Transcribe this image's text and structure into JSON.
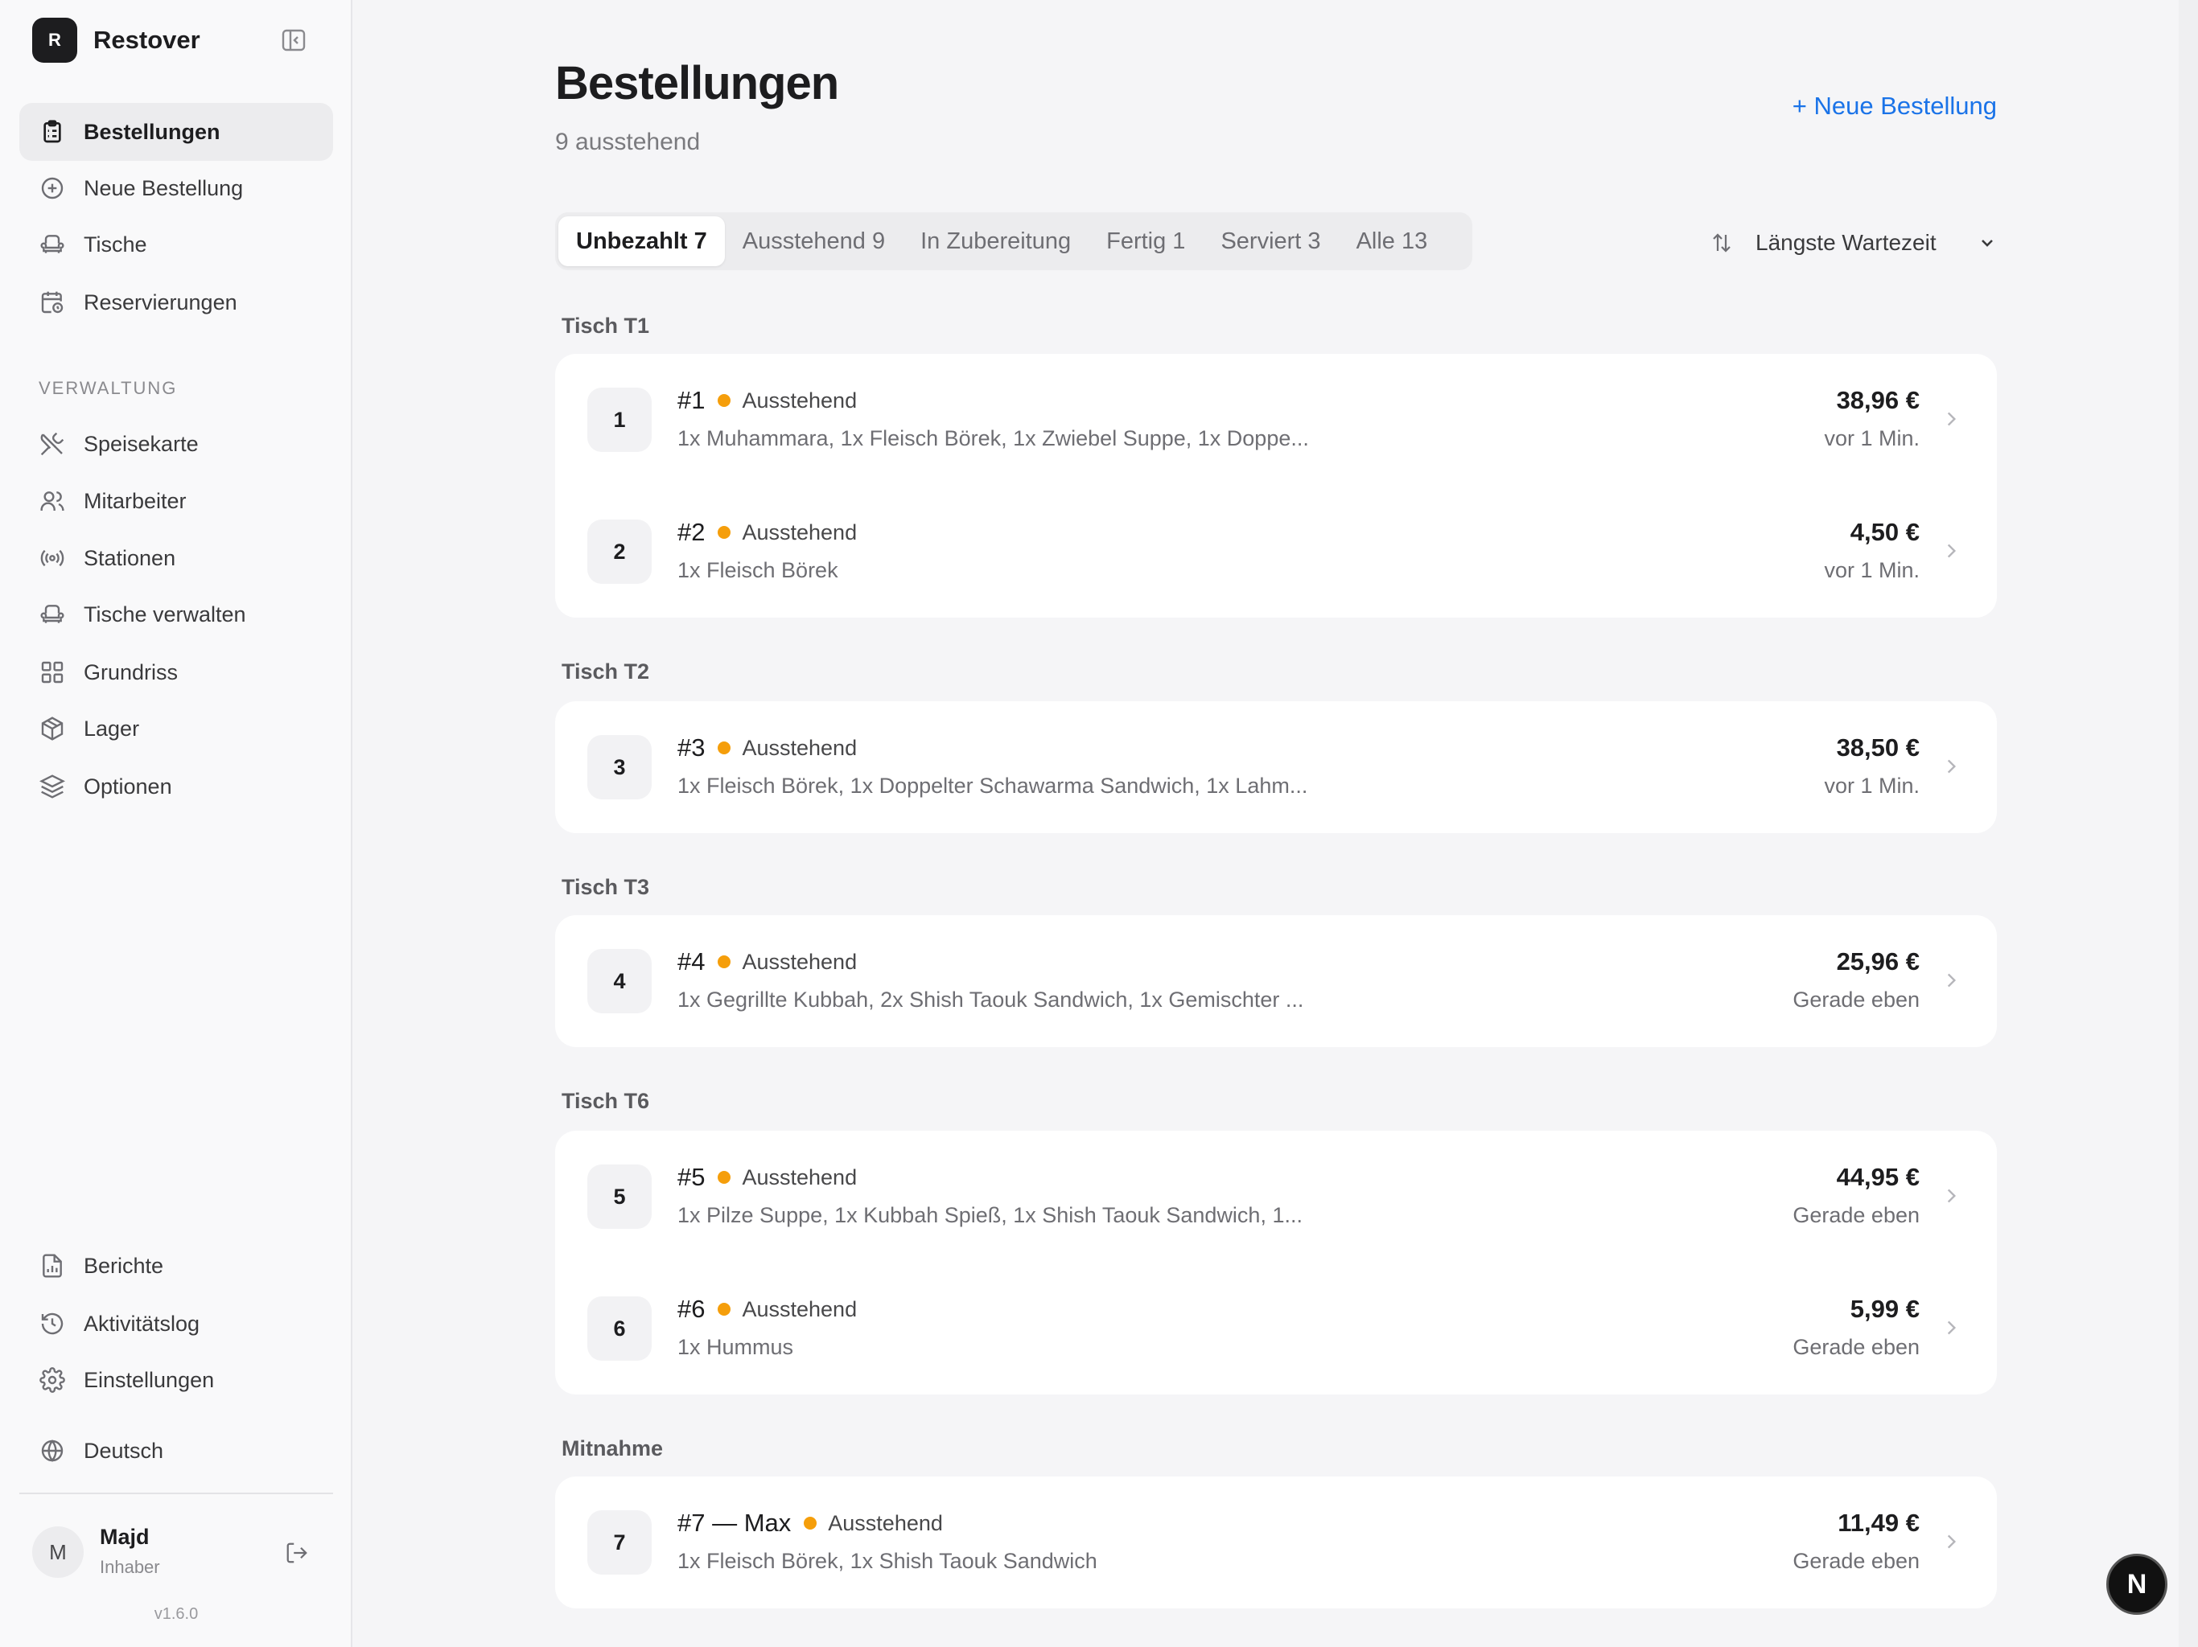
{
  "app": {
    "logo_letter": "R",
    "name": "Restover"
  },
  "sidebar": {
    "nav": [
      {
        "label": "Bestellungen",
        "icon": "clipboard-list-icon",
        "active": true
      },
      {
        "label": "Neue Bestellung",
        "icon": "plus-circle-icon"
      },
      {
        "label": "Tische",
        "icon": "armchair-icon"
      },
      {
        "label": "Reservierungen",
        "icon": "calendar-clock-icon"
      }
    ],
    "section_label": "VERWALTUNG",
    "admin": [
      {
        "label": "Speisekarte",
        "icon": "utensils-crossed-icon"
      },
      {
        "label": "Mitarbeiter",
        "icon": "users-icon"
      },
      {
        "label": "Stationen",
        "icon": "radio-tower-icon"
      },
      {
        "label": "Tische verwalten",
        "icon": "armchair-icon"
      },
      {
        "label": "Grundriss",
        "icon": "grid-icon"
      },
      {
        "label": "Lager",
        "icon": "package-icon"
      },
      {
        "label": "Optionen",
        "icon": "layers-icon"
      }
    ],
    "bottom": [
      {
        "label": "Berichte",
        "icon": "file-chart-icon"
      },
      {
        "label": "Aktivitätslog",
        "icon": "history-icon"
      },
      {
        "label": "Einstellungen",
        "icon": "gear-icon"
      },
      {
        "label": "Deutsch",
        "icon": "globe-icon"
      }
    ],
    "user": {
      "initial": "M",
      "name": "Majd",
      "role": "Inhaber"
    },
    "version": "v1.6.0"
  },
  "main": {
    "title": "Bestellungen",
    "subtitle": "9 ausstehend",
    "new_order_label": "+ Neue Bestellung",
    "tabs": [
      {
        "label": "Unbezahlt 7",
        "active": true
      },
      {
        "label": "Ausstehend 9"
      },
      {
        "label": "In Zubereitung"
      },
      {
        "label": "Fertig 1"
      },
      {
        "label": "Serviert 3"
      },
      {
        "label": "Alle 13"
      }
    ],
    "sort_label": "Längste Wartezeit",
    "groups": [
      {
        "label": "Tisch T1",
        "orders": [
          {
            "num": "1",
            "id": "#1",
            "status": "Ausstehend",
            "items": "1x Muhammara, 1x Fleisch Börek, 1x Zwiebel Suppe, 1x Doppe...",
            "price": "38,96 €",
            "time": "vor 1 Min."
          },
          {
            "num": "2",
            "id": "#2",
            "status": "Ausstehend",
            "items": "1x Fleisch Börek",
            "price": "4,50 €",
            "time": "vor 1 Min."
          }
        ]
      },
      {
        "label": "Tisch T2",
        "orders": [
          {
            "num": "3",
            "id": "#3",
            "status": "Ausstehend",
            "items": "1x Fleisch Börek, 1x Doppelter Schawarma Sandwich, 1x Lahm...",
            "price": "38,50 €",
            "time": "vor 1 Min."
          }
        ]
      },
      {
        "label": "Tisch T3",
        "orders": [
          {
            "num": "4",
            "id": "#4",
            "status": "Ausstehend",
            "items": "1x Gegrillte Kubbah, 2x Shish Taouk Sandwich, 1x Gemischter ...",
            "price": "25,96 €",
            "time": "Gerade eben"
          }
        ]
      },
      {
        "label": "Tisch T6",
        "orders": [
          {
            "num": "5",
            "id": "#5",
            "status": "Ausstehend",
            "items": "1x Pilze Suppe, 1x Kubbah Spieß, 1x Shish Taouk Sandwich, 1...",
            "price": "44,95 €",
            "time": "Gerade eben"
          },
          {
            "num": "6",
            "id": "#6",
            "status": "Ausstehend",
            "items": "1x Hummus",
            "price": "5,99 €",
            "time": "Gerade eben"
          }
        ]
      },
      {
        "label": "Mitnahme",
        "orders": [
          {
            "num": "7",
            "id": "#7 — Max",
            "status": "Ausstehend",
            "items": "1x Fleisch Börek, 1x Shish Taouk Sandwich",
            "price": "11,49 €",
            "time": "Gerade eben"
          }
        ]
      }
    ]
  },
  "fab_label": "N",
  "colors": {
    "accent": "#1a73e8",
    "status_pending": "#f59e0b",
    "text": "#1d1d1f"
  }
}
